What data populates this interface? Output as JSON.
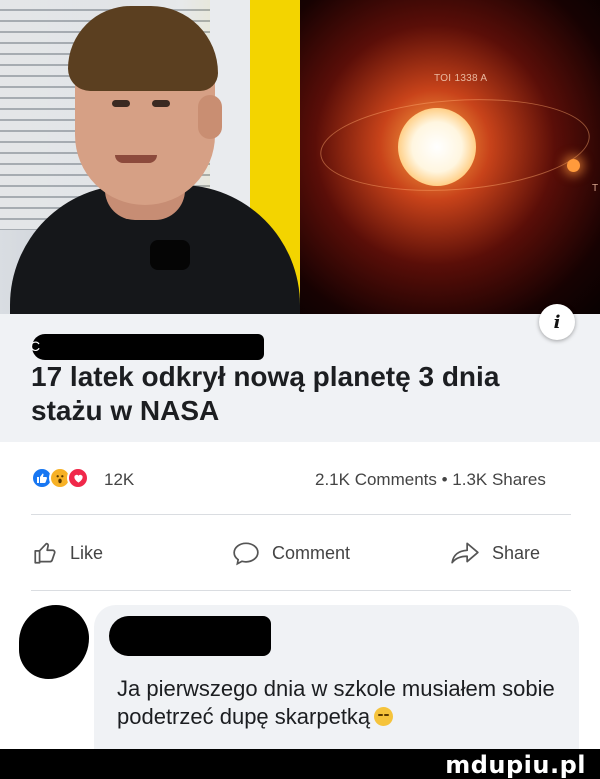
{
  "media": {
    "telescope_label": "TOI 1338 A",
    "edge_letter": "T"
  },
  "post": {
    "source_glyph": "C",
    "headline": "17 latek odkrył nową planetę 3 dnia stażu w NASA",
    "info_icon": "i"
  },
  "stats": {
    "reactions": [
      "like-icon",
      "wow-icon",
      "love-icon"
    ],
    "reaction_count": "12K",
    "comments_shares": "2.1K Comments • 1.3K Shares"
  },
  "actions": {
    "like_label": "Like",
    "comment_label": "Comment",
    "share_label": "Share"
  },
  "comment": {
    "text": "Ja pierwszego dnia w szkole musiałem sobie podetrzeć dupę skarpetką"
  },
  "watermark": {
    "text": "mdupiu.pl"
  },
  "colors": {
    "like_blue": "#1877f2",
    "wow_yellow": "#f7b125",
    "love_red": "#f0284a",
    "preview_bg": "#f0f2f5"
  }
}
